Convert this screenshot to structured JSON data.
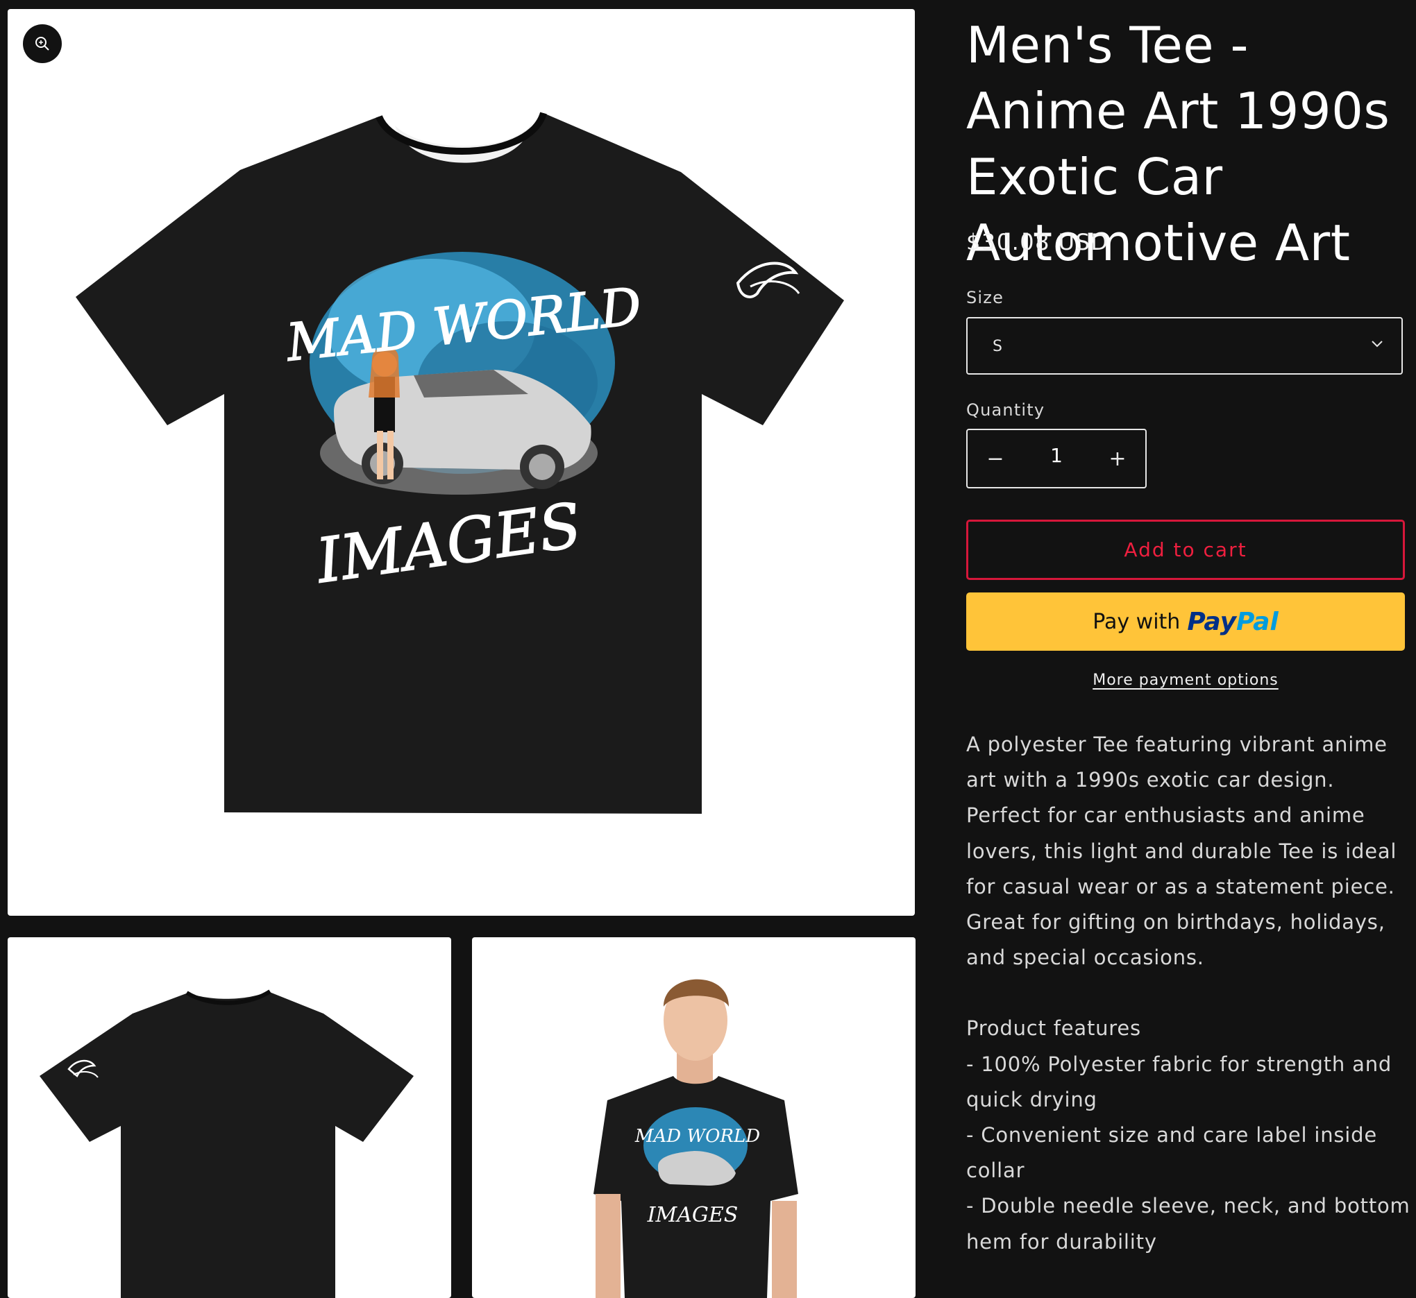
{
  "gallery": {
    "zoom_icon": "zoom-in-icon",
    "main_alt": "Black tee front with anime girl and silver exotic car graphic",
    "back_alt": "Black tee back",
    "model_alt": "Model wearing black tee",
    "graphic_text_top": "MAD WORLD",
    "graphic_text_bottom": "IMAGES"
  },
  "product": {
    "title": "Men's Tee - Anime Art 1990s Exotic Car Automotive Art",
    "price": "$30.08 USD",
    "size_label": "Size",
    "size_value": "S",
    "quantity_label": "Quantity",
    "quantity_value": "1",
    "minus_symbol": "−",
    "plus_symbol": "+",
    "add_to_cart": "Add to cart",
    "paypal_prefix": "Pay with",
    "paypal_brand_a": "Pay",
    "paypal_brand_b": "Pal",
    "more_payment": "More payment options"
  },
  "description": {
    "intro": "A polyester Tee featuring vibrant anime art with a 1990s exotic car design. Perfect for car enthusiasts and anime lovers, this light and durable Tee is ideal for casual wear or as a statement piece. Great for gifting on birthdays, holidays, and special occasions.",
    "features_heading": "Product features",
    "features": [
      "- 100% Polyester fabric for strength and quick drying",
      "- Convenient size and care label inside collar",
      "- Double needle sleeve, neck, and bottom hem for durability"
    ]
  },
  "colors": {
    "background": "#121212",
    "accent_red": "#d6173a",
    "paypal_yellow": "#ffc439",
    "paypal_navy": "#003087",
    "paypal_blue": "#009cde"
  }
}
